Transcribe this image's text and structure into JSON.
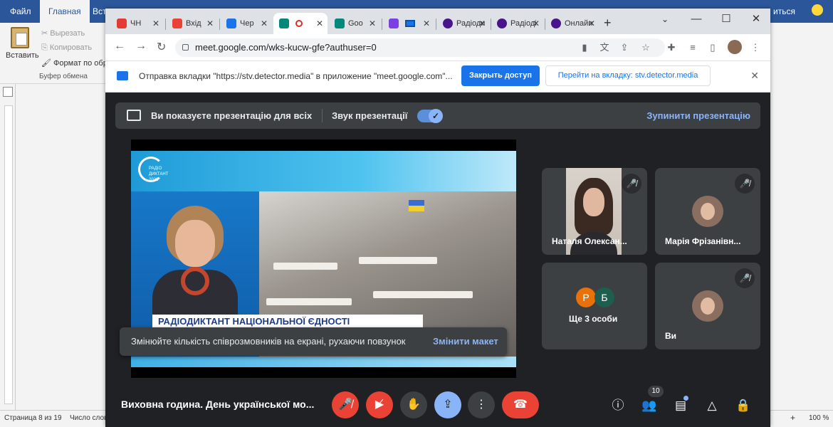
{
  "word": {
    "tabs": [
      "Файл",
      "Главная",
      "Вста"
    ],
    "clipboard": {
      "paste": "Вставить",
      "cut": "Вырезать",
      "copy": "Копировать",
      "format": "Формат по обр",
      "group": "Буфер обмена"
    },
    "top_right": "иться",
    "status": {
      "page": "Страница 8 из 19",
      "words": "Число слов",
      "zoom": "100 %"
    }
  },
  "browser": {
    "tabs": [
      {
        "label": "ЧН",
        "icon": "news-icon",
        "color": "#e53935"
      },
      {
        "label": "Вхід",
        "icon": "gmail-icon",
        "color": "#ea4335"
      },
      {
        "label": "Чер",
        "icon": "calendar-icon",
        "color": "#1a73e8"
      },
      {
        "label": "",
        "icon": "meet-icon",
        "color": "#00897b",
        "active": true
      },
      {
        "label": "Goo",
        "icon": "meet-icon",
        "color": "#00897b"
      },
      {
        "label": "",
        "icon": "canva-icon",
        "color": "#7b3fe4"
      },
      {
        "label": "Радіоди",
        "icon": "site-icon",
        "color": "#4a148c"
      },
      {
        "label": "Радіоді",
        "icon": "site-icon",
        "color": "#4a148c"
      },
      {
        "label": "Онлайн",
        "icon": "site-icon",
        "color": "#4a148c"
      }
    ],
    "url": "meet.google.com/wks-kucw-gfe?authuser=0",
    "infobar": {
      "message": "Отправка вкладки \"https://stv.detector.media\" в приложение \"meet.google.com\"...",
      "close_access": "Закрыть доступ",
      "go_to_tab": "Перейти на вкладку: stv.detector.media"
    }
  },
  "meet": {
    "presenting": "Ви показуєте презентацію для всіх",
    "audio": "Звук презентації",
    "stop": "Зупинити презентацію",
    "tooltip": "Змінюйте кількість співрозмовників на екрані, рухаючи повзунок",
    "tooltip_link": "Змінити макет",
    "slide": {
      "logo": "РАДІО ДИКТАНТ 2022",
      "ticker": "РАДІОДИКТАНТ НАЦІОНАЛЬНОЇ ЄДНОСТІ"
    },
    "participants": [
      {
        "name": "Наталя Олексан..."
      },
      {
        "name": "Марія Фрізанівн..."
      },
      {
        "name": "Ще 3 особи",
        "initials": [
          "Р",
          "Б"
        ],
        "colors": [
          "#e8710a",
          "#1e5e4e"
        ]
      },
      {
        "name": "Ви"
      }
    ],
    "meeting_title": "Виховна година. День української мо...",
    "people_count": "10"
  }
}
